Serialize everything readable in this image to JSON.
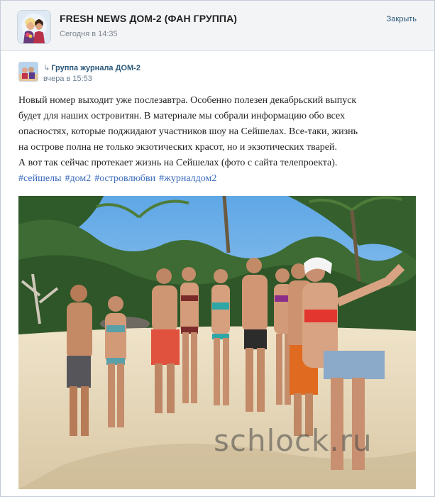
{
  "header": {
    "group_name": "FRESH NEWS ДОМ-2 (ФАН ГРУППА)",
    "time": "Сегодня в 14:35",
    "close_label": "Закрыть"
  },
  "repost": {
    "source_name": "Группа журнала ДОМ-2",
    "time": "вчера в 15:53"
  },
  "post": {
    "lines": [
      "Новый номер выходит уже послезавтра. Особенно полезен декабрьский выпуск",
      "будет для наших островитян. В материале мы собрали информацию обо всех",
      "опасностях, которые поджидают участников шоу на Сейшелах. Все-таки, жизнь",
      "на острове полна не только экзотических красот, но и экзотических тварей.",
      "А вот так сейчас протекает жизнь на Сейшелах (фото с сайта телепроекта)."
    ],
    "hashtags": [
      "#сейшелы",
      "#дом2",
      "#островлюбви",
      "#журналдом2"
    ]
  },
  "photo": {
    "watermark": "schlock.ru"
  }
}
